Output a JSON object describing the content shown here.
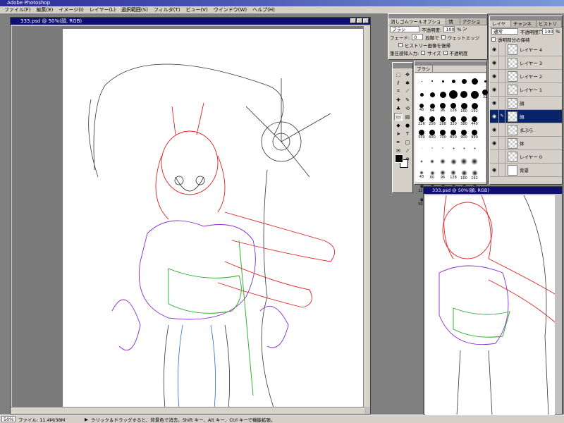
{
  "app_title": "Adobe Photoshop",
  "menu": [
    "ファイル(F)",
    "編集(E)",
    "イメージ(I)",
    "レイヤー(L)",
    "選択範囲(S)",
    "フィルタ(T)",
    "ビュー(V)",
    "ウインドウ(W)",
    "ヘルプ(H)"
  ],
  "document": {
    "title": "333.psd @ 50%(顔, RGB)"
  },
  "document2": {
    "title": "333.psd @ 50%(顔, RGB)"
  },
  "options_panel": {
    "tabs": [
      "消しゴムツールオプション",
      "情報",
      "アクション"
    ],
    "mode": "ブラシ",
    "opacity_label": "不透明度:",
    "opacity_value": "100",
    "opacity_unit": "%",
    "fade_label": "フェード:",
    "fade_value": "0",
    "fade_unit": "段階で",
    "wet_edges_label": "ウェットエッジ",
    "history_label": "ヒストリー画像を復帰",
    "pressure_label": "筆圧感知入力:",
    "size_label": "サイズ",
    "pressure_opacity_label": "不透明度"
  },
  "brushes_panel": {
    "tab": "ブラシ",
    "brushes": [
      {
        "size": "",
        "d": 1,
        "soft": false
      },
      {
        "size": "",
        "d": 2,
        "soft": false
      },
      {
        "size": "",
        "d": 3,
        "soft": false
      },
      {
        "size": "",
        "d": 5,
        "soft": false
      },
      {
        "size": "",
        "d": 7,
        "soft": false
      },
      {
        "size": "",
        "d": 9,
        "soft": false
      },
      {
        "size": "",
        "d": 3,
        "soft": false
      },
      {
        "size": "",
        "d": 4,
        "soft": false
      },
      {
        "size": "",
        "d": 5,
        "soft": false
      },
      {
        "size": "",
        "d": 7,
        "soft": false
      },
      {
        "size": "",
        "d": 9,
        "soft": false
      },
      {
        "size": "",
        "d": 12,
        "soft": false
      },
      {
        "size": "",
        "d": 10,
        "soft": false
      },
      {
        "size": "",
        "d": 11,
        "soft": false
      },
      {
        "size": "32",
        "d": 8,
        "soft": false
      },
      {
        "size": "",
        "d": 0,
        "soft": false
      },
      {
        "size": "48",
        "d": 6,
        "soft": false
      },
      {
        "size": "64",
        "d": 7,
        "soft": false
      },
      {
        "size": "96",
        "d": 8,
        "soft": false
      },
      {
        "size": "128",
        "d": 8,
        "soft": false
      },
      {
        "size": "160",
        "d": 9,
        "soft": false
      },
      {
        "size": "192",
        "d": 9,
        "soft": false
      },
      {
        "size": "",
        "d": 0,
        "soft": false
      },
      {
        "size": "",
        "d": 0,
        "soft": false
      },
      {
        "size": "226",
        "d": 8,
        "soft": false
      },
      {
        "size": "256",
        "d": 8,
        "soft": false
      },
      {
        "size": "288",
        "d": 8,
        "soft": false
      },
      {
        "size": "320",
        "d": 8,
        "soft": false
      },
      {
        "size": "380",
        "d": 8,
        "soft": false
      },
      {
        "size": "440",
        "d": 8,
        "soft": false
      },
      {
        "size": "",
        "d": 0,
        "soft": false
      },
      {
        "size": "",
        "d": 0,
        "soft": false
      },
      {
        "size": "500",
        "d": 8,
        "soft": false
      },
      {
        "size": "600",
        "d": 8,
        "soft": false
      },
      {
        "size": "700",
        "d": 8,
        "soft": false
      },
      {
        "size": "800",
        "d": 8,
        "soft": false
      },
      {
        "size": "900",
        "d": 8,
        "soft": false
      },
      {
        "size": "999",
        "d": 8,
        "soft": false
      },
      {
        "size": "",
        "d": 0,
        "soft": false
      },
      {
        "size": "",
        "d": 0,
        "soft": false
      },
      {
        "size": "",
        "d": 1,
        "soft": true
      },
      {
        "size": "",
        "d": 2,
        "soft": true
      },
      {
        "size": "",
        "d": 2,
        "soft": true
      },
      {
        "size": "",
        "d": 3,
        "soft": true
      },
      {
        "size": "",
        "d": 3,
        "soft": true
      },
      {
        "size": "",
        "d": 3,
        "soft": true
      },
      {
        "size": "",
        "d": 0,
        "soft": false
      },
      {
        "size": "",
        "d": 0,
        "soft": false
      },
      {
        "size": "",
        "d": 4,
        "soft": true
      },
      {
        "size": "",
        "d": 6,
        "soft": true
      },
      {
        "size": "",
        "d": 8,
        "soft": true
      },
      {
        "size": "",
        "d": 9,
        "soft": true
      },
      {
        "size": "",
        "d": 10,
        "soft": true
      },
      {
        "size": "",
        "d": 10,
        "soft": true
      },
      {
        "size": "",
        "d": 0,
        "soft": false
      },
      {
        "size": "",
        "d": 0,
        "soft": false
      },
      {
        "size": "43",
        "d": 6,
        "soft": true
      },
      {
        "size": "60",
        "d": 7,
        "soft": true
      },
      {
        "size": "96",
        "d": 8,
        "soft": true
      },
      {
        "size": "128",
        "d": 8,
        "soft": true
      },
      {
        "size": "160",
        "d": 9,
        "soft": true
      },
      {
        "size": "192",
        "d": 9,
        "soft": true
      },
      {
        "size": "",
        "d": 0,
        "soft": false
      },
      {
        "size": "",
        "d": 0,
        "soft": false
      },
      {
        "size": "226",
        "d": 7,
        "soft": true
      },
      {
        "size": "256",
        "d": 7,
        "soft": true
      },
      {
        "size": "288",
        "d": 7,
        "soft": true
      },
      {
        "size": "320",
        "d": 7,
        "soft": true
      },
      {
        "size": "380",
        "d": 7,
        "soft": true
      },
      {
        "size": "440",
        "d": 7,
        "soft": true
      },
      {
        "size": "",
        "d": 0,
        "soft": false
      },
      {
        "size": "",
        "d": 0,
        "soft": false
      },
      {
        "size": "500",
        "d": 7,
        "soft": true
      },
      {
        "size": "600",
        "d": 7,
        "soft": true
      },
      {
        "size": "700",
        "d": 7,
        "soft": true
      },
      {
        "size": "800",
        "d": 7,
        "soft": true
      },
      {
        "size": "900",
        "d": 7,
        "soft": true
      },
      {
        "size": "999",
        "d": 7,
        "soft": true
      },
      {
        "size": "",
        "d": 0,
        "soft": false
      },
      {
        "size": "",
        "d": 0,
        "soft": false
      }
    ]
  },
  "layers_panel": {
    "tabs": [
      "レイヤー",
      "チャンネル",
      "ヒストリー"
    ],
    "blend_mode": "通常",
    "opacity_label": "不透明度:",
    "opacity_value": "100",
    "opacity_unit": "%",
    "preserve_label": "透明部分の保持",
    "layers": [
      {
        "name": "レイヤー 4",
        "visible": true,
        "selected": false,
        "thumb": "checker"
      },
      {
        "name": "レイヤー 3",
        "visible": true,
        "selected": false,
        "thumb": "checker"
      },
      {
        "name": "レイヤー 2",
        "visible": true,
        "selected": false,
        "thumb": "checker"
      },
      {
        "name": "レイヤー 1",
        "visible": true,
        "selected": false,
        "thumb": "checker"
      },
      {
        "name": "顔",
        "visible": true,
        "selected": false,
        "thumb": "checker"
      },
      {
        "name": "顔",
        "visible": true,
        "selected": true,
        "thumb": "checker"
      },
      {
        "name": "まぶら",
        "visible": true,
        "selected": false,
        "thumb": "checker"
      },
      {
        "name": "体",
        "visible": true,
        "selected": false,
        "thumb": "checker"
      },
      {
        "name": "レイヤー 0",
        "visible": false,
        "selected": false,
        "thumb": "checker"
      },
      {
        "name": "背景",
        "visible": true,
        "selected": false,
        "thumb": "white"
      }
    ]
  },
  "tools": [
    "marquee-icon",
    "move-icon",
    "lasso-icon",
    "magic-wand-icon",
    "crop-icon",
    "slice-icon",
    "healing-icon",
    "brush-icon",
    "stamp-icon",
    "history-brush-icon",
    "eraser-icon",
    "gradient-icon",
    "blur-icon",
    "dodge-icon",
    "path-select-icon",
    "type-icon",
    "pen-icon",
    "shape-icon",
    "notes-icon",
    "eyedropper-icon",
    "hand-icon",
    "zoom-icon"
  ],
  "status": {
    "zoom": "50%",
    "file_info": "ファイル: 11.4M/38M",
    "hint": "クリック＆ドラッグすると、背景色で消去。Shift キー、Alt キー、Ctrl キーで機能拡張。"
  }
}
